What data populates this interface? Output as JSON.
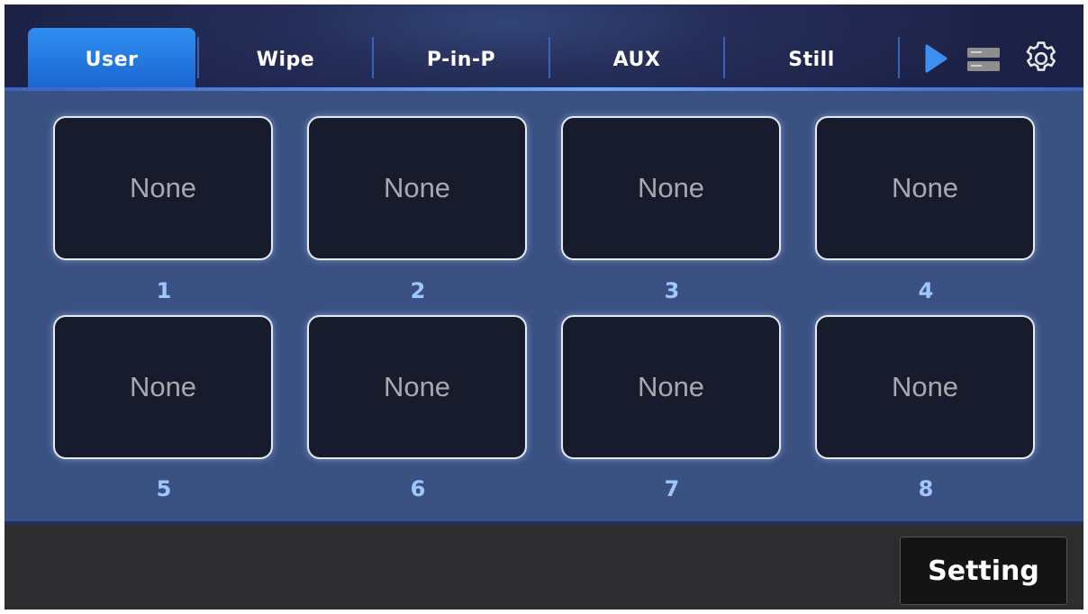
{
  "tabs": [
    {
      "label": "User",
      "active": true
    },
    {
      "label": "Wipe",
      "active": false
    },
    {
      "label": "P-in-P",
      "active": false
    },
    {
      "label": "AUX",
      "active": false
    },
    {
      "label": "Still",
      "active": false
    }
  ],
  "toolbar": {
    "icons": [
      "play-icon",
      "layers-icon",
      "gear-icon"
    ],
    "accent": "#2f8ff2"
  },
  "slots": [
    {
      "number": "1",
      "value": "None"
    },
    {
      "number": "2",
      "value": "None"
    },
    {
      "number": "3",
      "value": "None"
    },
    {
      "number": "4",
      "value": "None"
    },
    {
      "number": "5",
      "value": "None"
    },
    {
      "number": "6",
      "value": "None"
    },
    {
      "number": "7",
      "value": "None"
    },
    {
      "number": "8",
      "value": "None"
    }
  ],
  "footer": {
    "setting_label": "Setting"
  }
}
